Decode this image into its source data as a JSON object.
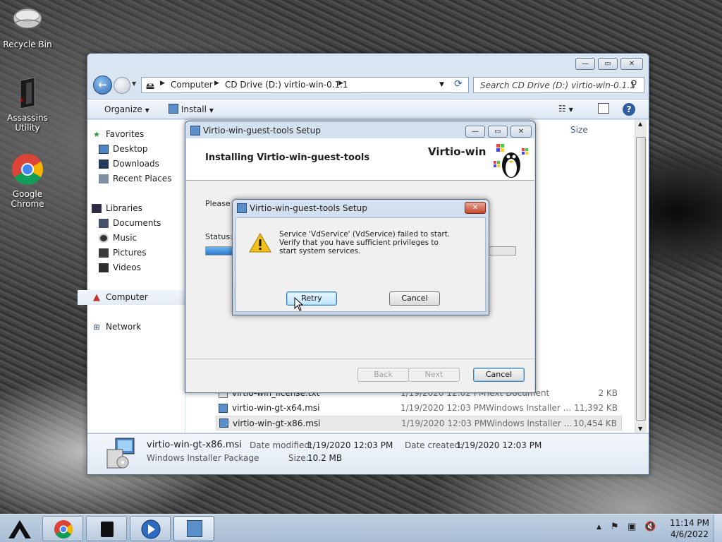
{
  "desktop": {
    "icons": [
      {
        "label": "Recycle Bin"
      },
      {
        "label": "Assassins Utility"
      },
      {
        "label": "Google Chrome"
      }
    ]
  },
  "explorer": {
    "breadcrumb": [
      "Computer",
      "CD Drive (D:) virtio-win-0.1.1"
    ],
    "search_placeholder": "Search CD Drive (D:) virtio-win-0.1.1",
    "toolbar": {
      "organize": "Organize",
      "install": "Install"
    },
    "column_size": "Size",
    "nav": {
      "favorites": "Favorites",
      "desktop": "Desktop",
      "downloads": "Downloads",
      "recent": "Recent Places",
      "libraries": "Libraries",
      "documents": "Documents",
      "music": "Music",
      "pictures": "Pictures",
      "videos": "Videos",
      "computer": "Computer",
      "network": "Network"
    },
    "files": [
      {
        "name": "virtio-win_license.txt",
        "date": "1/19/2020 12:02 PM",
        "type": "Text Document",
        "size": "2 KB"
      },
      {
        "name": "virtio-win-gt-x64.msi",
        "date": "1/19/2020 12:03 PM",
        "type": "Windows Installer ...",
        "size": "11,392 KB"
      },
      {
        "name": "virtio-win-gt-x86.msi",
        "date": "1/19/2020 12:03 PM",
        "type": "Windows Installer ...",
        "size": "10,454 KB"
      }
    ],
    "details": {
      "name": "virtio-win-gt-x86.msi",
      "type": "Windows Installer Package",
      "modified_label": "Date modified:",
      "modified": "1/19/2020 12:03 PM",
      "created_label": "Date created:",
      "created": "1/19/2020 12:03 PM",
      "size_label": "Size:",
      "size": "10.2 MB"
    }
  },
  "setup": {
    "title": "Virtio-win-guest-tools Setup",
    "heading": "Installing Virtio-win-guest-tools",
    "brand": "Virtio-win",
    "please_wait": "Please w",
    "status_label": "Status:",
    "progress": 0.1,
    "back": "Back",
    "next": "Next",
    "cancel": "Cancel"
  },
  "error_dialog": {
    "title": "Virtio-win-guest-tools Setup",
    "message": "Service 'VdService' (VdService) failed to start.  Verify that you have sufficient privileges to start system services.",
    "retry": "Retry",
    "cancel": "Cancel"
  },
  "taskbar": {
    "time": "11:14 PM",
    "date": "4/6/2022"
  }
}
